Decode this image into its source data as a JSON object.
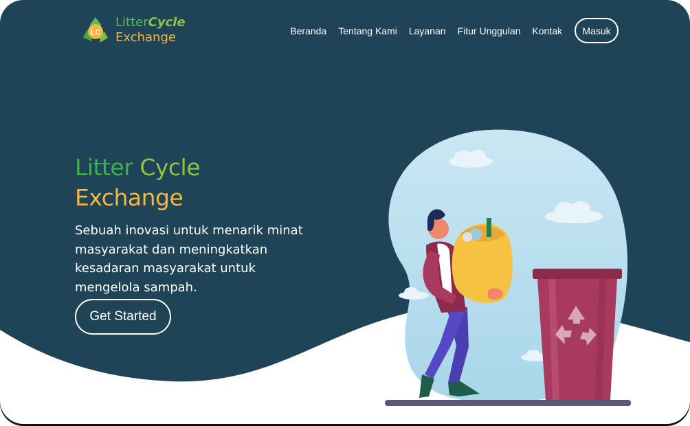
{
  "brand": {
    "logo_initials": "LC",
    "logo_word1": "Litter",
    "logo_word2": "Cycle",
    "logo_word3": "Exchange"
  },
  "nav": {
    "items": [
      {
        "label": "Beranda"
      },
      {
        "label": "Tentang Kami"
      },
      {
        "label": "Layanan"
      },
      {
        "label": "Fitur Unggulan"
      },
      {
        "label": "Kontak"
      }
    ],
    "login_label": "Masuk"
  },
  "hero": {
    "title_word1": "Litter",
    "title_word2": "Cycle",
    "title_line2": "Exchange",
    "subtitle": "Sebuah inovasi untuk menarik minat masyarakat dan meningkatkan kesadaran masyarakat untuk mengelola sampah.",
    "cta_label": "Get Started"
  },
  "colors": {
    "hero_bg": "#1f4457",
    "green": "#3fb04a",
    "light_green": "#8cc63f",
    "yellow": "#f4b63f",
    "bin": "#a83a5f"
  },
  "icons": [
    "recycle-logo-icon",
    "recycle-symbol-icon"
  ]
}
